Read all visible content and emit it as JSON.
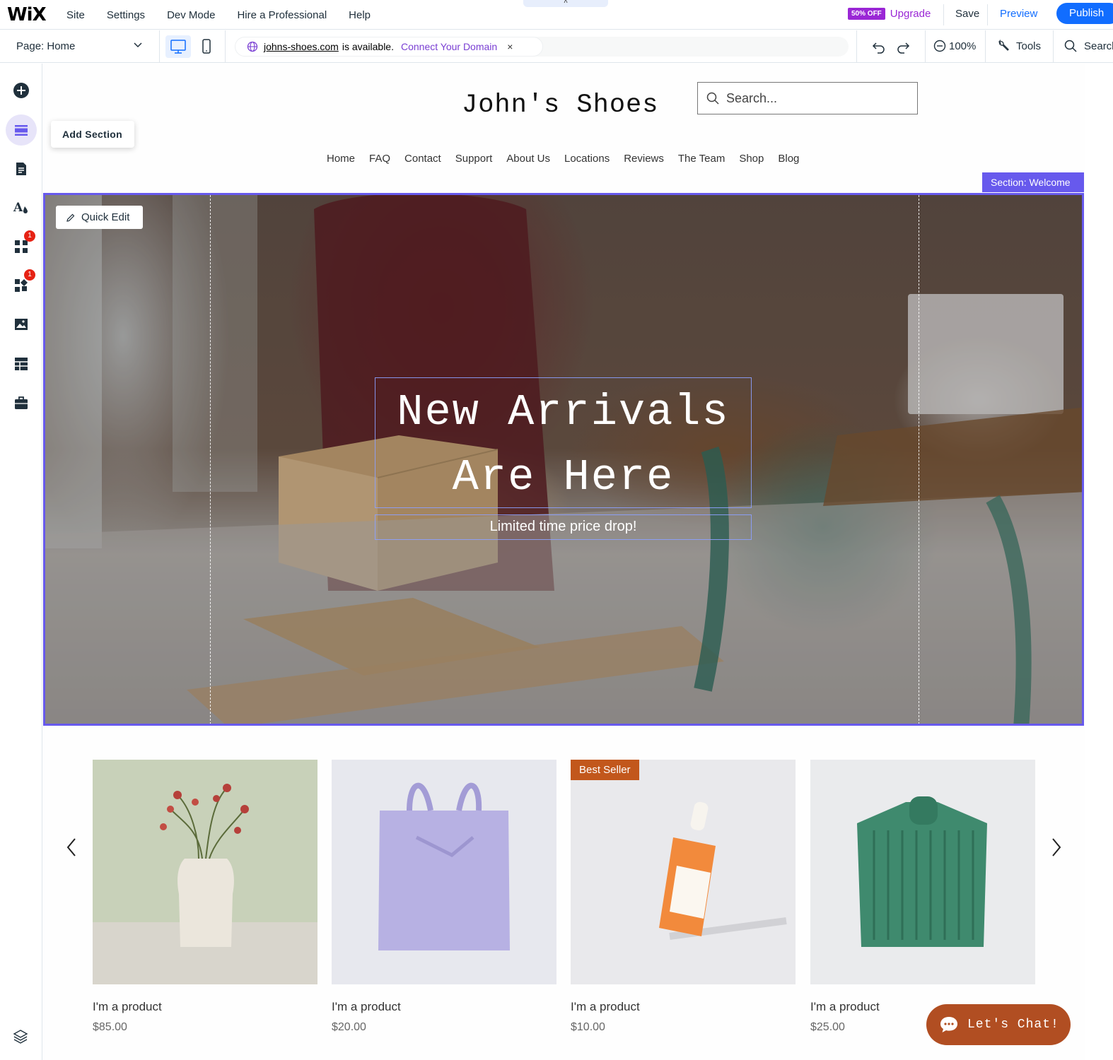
{
  "topbar": {
    "logo": "WiX",
    "menu": [
      "Site",
      "Settings",
      "Dev Mode",
      "Hire a Professional",
      "Help"
    ],
    "pull_tab": "˄",
    "upgrade_badge": "50% OFF",
    "upgrade_label": "Upgrade",
    "save_label": "Save",
    "preview_label": "Preview",
    "publish_label": "Publish"
  },
  "bar2": {
    "page_select": "Page: Home",
    "domain_name": "johns-shoes.com",
    "domain_text": "is available.",
    "connect_label": "Connect Your Domain",
    "close_label": "×",
    "zoom_label": "100%",
    "tools_label": "Tools",
    "search_label": "Search"
  },
  "rail": {
    "tooltip": "Add Section",
    "notifications": [
      "1",
      "1"
    ]
  },
  "site": {
    "title": "John's Shoes",
    "search_placeholder": "Search...",
    "nav": [
      "Home",
      "FAQ",
      "Contact",
      "Support",
      "About Us",
      "Locations",
      "Reviews",
      "The Team",
      "Shop",
      "Blog"
    ]
  },
  "hero": {
    "quick_edit": "Quick Edit",
    "section_tag": "Section: Welcome",
    "headline_1": "New Arrivals",
    "headline_2": "Are Here",
    "subtitle": "Limited time price drop!"
  },
  "products": [
    {
      "name": "I'm a product",
      "price": "$85.00",
      "badge": ""
    },
    {
      "name": "I'm a product",
      "price": "$20.00",
      "badge": ""
    },
    {
      "name": "I'm a product",
      "price": "$10.00",
      "badge": "Best Seller"
    },
    {
      "name": "I'm a product",
      "price": "$25.00",
      "badge": ""
    }
  ],
  "chat_label": "Let's Chat!",
  "colors": {
    "accent": "#116dff",
    "section_outline": "#6759ed",
    "upgrade_purple": "#9a27d5",
    "best_seller": "#c2571c",
    "chat": "#b14e22"
  }
}
